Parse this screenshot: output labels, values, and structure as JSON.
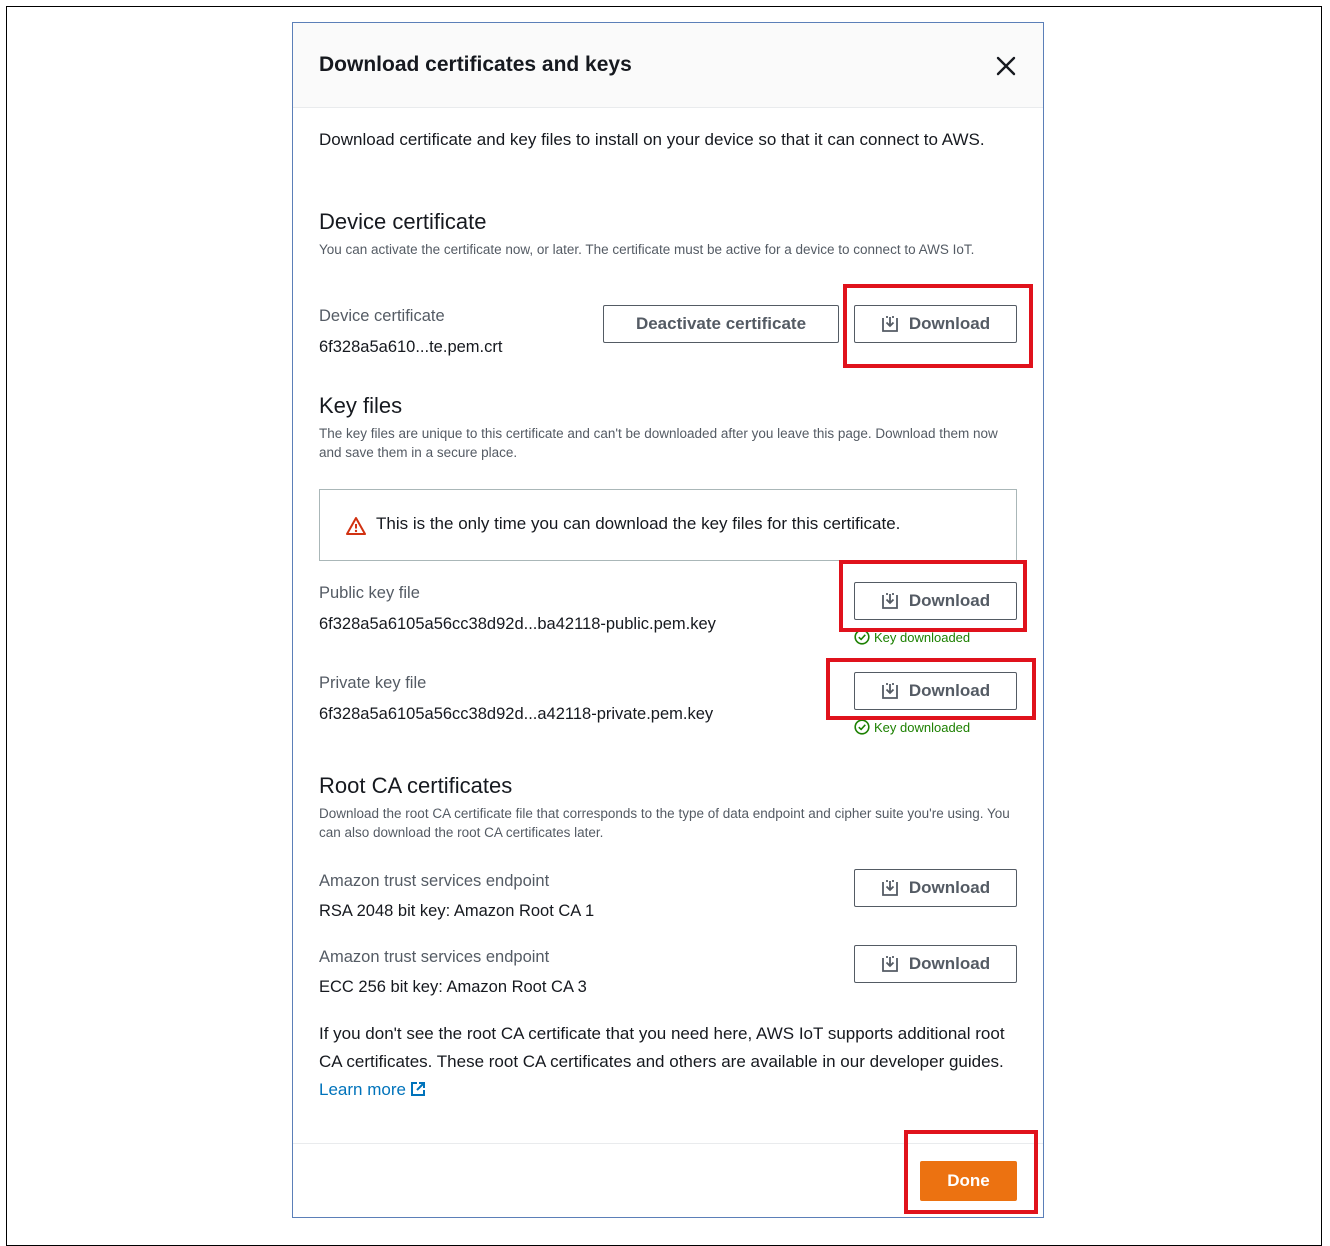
{
  "modal": {
    "title": "Download certificates and keys",
    "intro": "Download certificate and key files to install on your device so that it can connect to AWS."
  },
  "device_certificate": {
    "heading": "Device certificate",
    "description": "You can activate the certificate now, or later. The certificate must be active for a device to connect to AWS IoT.",
    "label": "Device certificate",
    "filename": "6f328a5a610...te.pem.crt",
    "deactivate_label": "Deactivate certificate",
    "download_label": "Download"
  },
  "key_files": {
    "heading": "Key files",
    "description": "The key files are unique to this certificate and can't be downloaded after you leave this page. Download them now and save them in a secure place.",
    "alert": "This is the only time you can download the key files for this certificate.",
    "public": {
      "label": "Public key file",
      "filename": "6f328a5a6105a56cc38d92d...ba42118-public.pem.key",
      "download_label": "Download",
      "status": "Key downloaded"
    },
    "private": {
      "label": "Private key file",
      "filename": "6f328a5a6105a56cc38d92d...a42118-private.pem.key",
      "download_label": "Download",
      "status": "Key downloaded"
    }
  },
  "root_ca": {
    "heading": "Root CA certificates",
    "description": "Download the root CA certificate file that corresponds to the type of data endpoint and cipher suite you're using. You can also download the root CA certificates later.",
    "rsa": {
      "label": "Amazon trust services endpoint",
      "value": "RSA 2048 bit key: Amazon Root CA 1",
      "download_label": "Download"
    },
    "ecc": {
      "label": "Amazon trust services endpoint",
      "value": "ECC 256 bit key: Amazon Root CA 3",
      "download_label": "Download"
    },
    "footer_note": "If you don't see the root CA certificate that you need here, AWS IoT supports additional root CA certificates. These root CA certificates and others are available in our developer guides.",
    "learn_more": "Learn more"
  },
  "footer": {
    "done_label": "Done"
  },
  "colors": {
    "primary_button": "#ec7211",
    "link": "#0073bb",
    "success": "#1d8102",
    "warning": "#d13212",
    "highlight": "#e0121c"
  },
  "icons": [
    "close-icon",
    "download-icon",
    "warning-icon",
    "check-circle-icon",
    "external-link-icon"
  ]
}
